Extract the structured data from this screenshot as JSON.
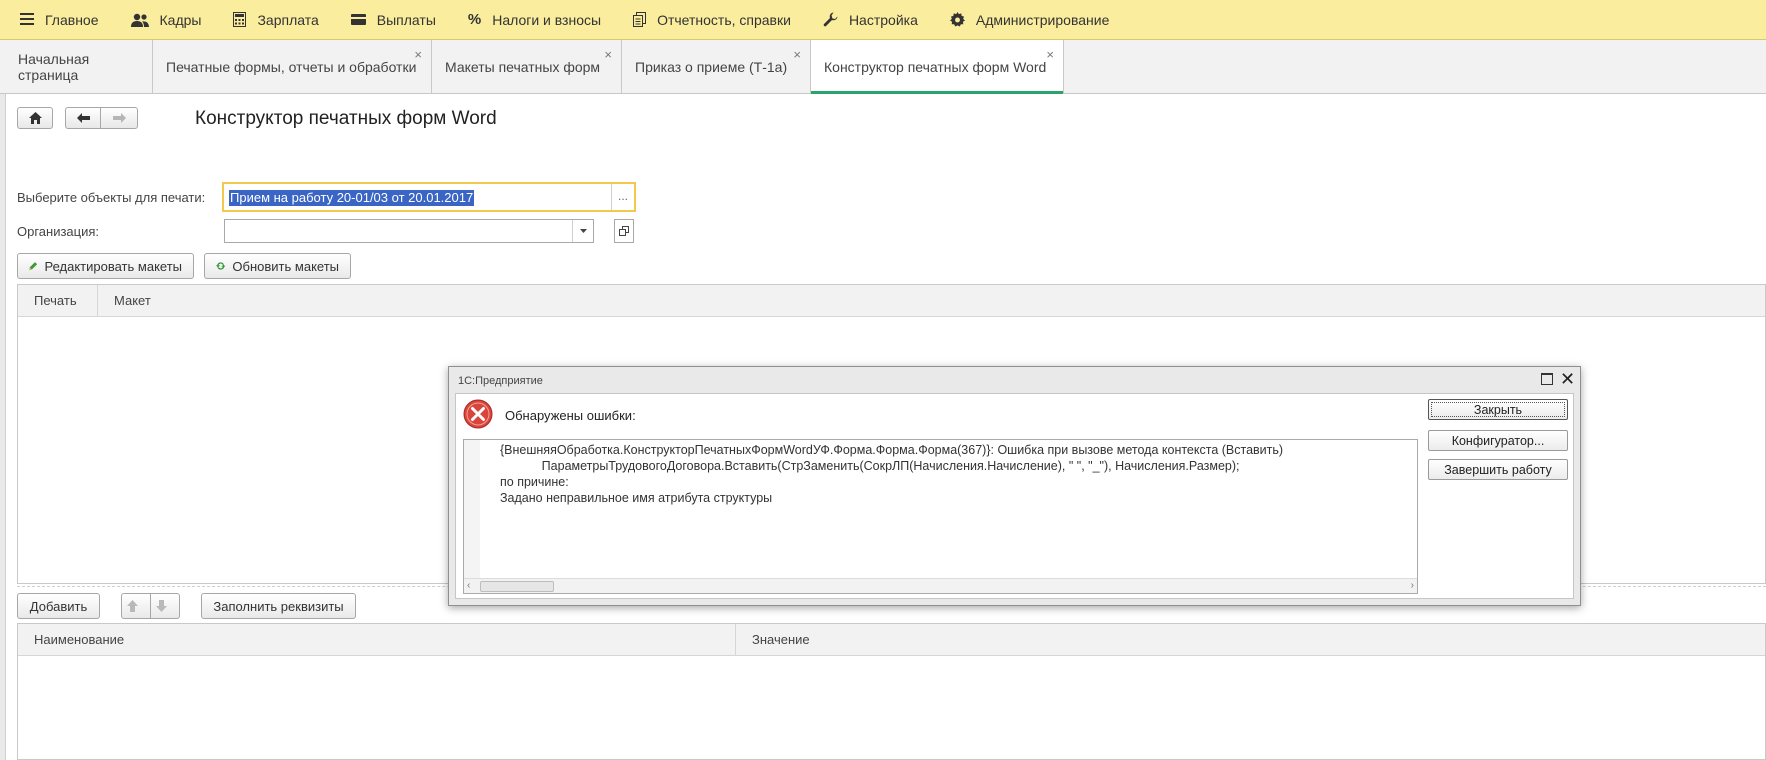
{
  "menu": {
    "items": [
      {
        "label": "Главное",
        "icon": "hamburger-icon"
      },
      {
        "label": "Кадры",
        "icon": "people-icon"
      },
      {
        "label": "Зарплата",
        "icon": "calculator-icon"
      },
      {
        "label": "Выплаты",
        "icon": "wallet-icon"
      },
      {
        "label": "Налоги и взносы",
        "icon": "percent-icon"
      },
      {
        "label": "Отчетность, справки",
        "icon": "documents-icon"
      },
      {
        "label": "Настройка",
        "icon": "wrench-icon"
      },
      {
        "label": "Администрирование",
        "icon": "gear-icon"
      }
    ]
  },
  "tabs": [
    {
      "label": "Начальная страница"
    },
    {
      "label": "Печатные формы, отчеты и обработки"
    },
    {
      "label": "Макеты печатных форм"
    },
    {
      "label": "Приказ о приеме (Т-1а)"
    },
    {
      "label": "Конструктор печатных форм Word"
    }
  ],
  "page": {
    "title": "Конструктор печатных форм Word",
    "select_objects_label": "Выберите объекты для печати:",
    "select_objects_value": "Прием на работу 20-01/03 от 20.01.2017",
    "select_more": "...",
    "organization_label": "Организация:",
    "organization_value": ""
  },
  "toolbar": {
    "edit_layouts": "Редактировать макеты",
    "refresh_layouts": "Обновить макеты",
    "add": "Добавить",
    "fill_attributes": "Заполнить реквизиты"
  },
  "print_table": {
    "columns": [
      "Печать",
      "Макет"
    ]
  },
  "attr_table": {
    "columns": [
      "Наименование",
      "Значение"
    ]
  },
  "dialog": {
    "title": "1С:Предприятие",
    "header": "Обнаружены ошибки:",
    "lines": [
      "{ВнешняяОбработка.КонструкторПечатныхФормWordУФ.Форма.Форма.Форма(367)}: Ошибка при вызове метода контекста (Вставить)",
      "            ПараметрыТрудовогоДоговора.Вставить(СтрЗаменить(СокрЛП(Начисления.Начисление), \" \", \"_\"), Начисления.Размер);",
      "по причине:",
      "Задано неправильное имя атрибута структуры"
    ],
    "buttons": {
      "close": "Закрыть",
      "configurator": "Конфигуратор...",
      "exit": "Завершить работу"
    }
  },
  "colors": {
    "menu_bg": "#fbed9e",
    "active_tab_bar": "#2aa36c",
    "selection": "#3a65c4",
    "error_icon": "#d9443b"
  }
}
